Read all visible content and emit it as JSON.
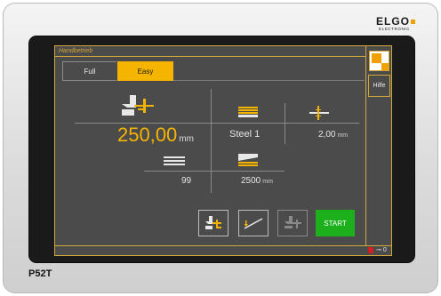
{
  "device": {
    "brand": "ELGO",
    "brand_sub": "ELECTRONIC",
    "model": "P52T"
  },
  "screen": {
    "title": "Handbetrieb",
    "help_label": "Hilfe",
    "tabs": [
      {
        "label": "Full",
        "active": false
      },
      {
        "label": "Easy",
        "active": true
      }
    ],
    "position": {
      "value": "250,00",
      "unit": "mm"
    },
    "material": {
      "value": "Steel 1"
    },
    "thickness": {
      "value": "2,00",
      "unit": "mm"
    },
    "count": {
      "value": "99"
    },
    "length": {
      "value": "2500",
      "unit": "mm"
    },
    "actions": {
      "start_label": "START"
    },
    "status": {
      "indicator_text": "0"
    }
  },
  "colors": {
    "accent": "#f5b400",
    "start_green": "#1db01d",
    "screen_bg": "#4b4b4b",
    "frame_gold": "#d4a73a",
    "led_red": "#d21f1f"
  },
  "icons": [
    "tool-position-icon",
    "stack-sheets-icon",
    "crosshair-icon",
    "sheet-stack-icon",
    "press-bend-icon",
    "tool-select-icon",
    "ramp-icon",
    "tool-move-icon",
    "key-icon"
  ]
}
